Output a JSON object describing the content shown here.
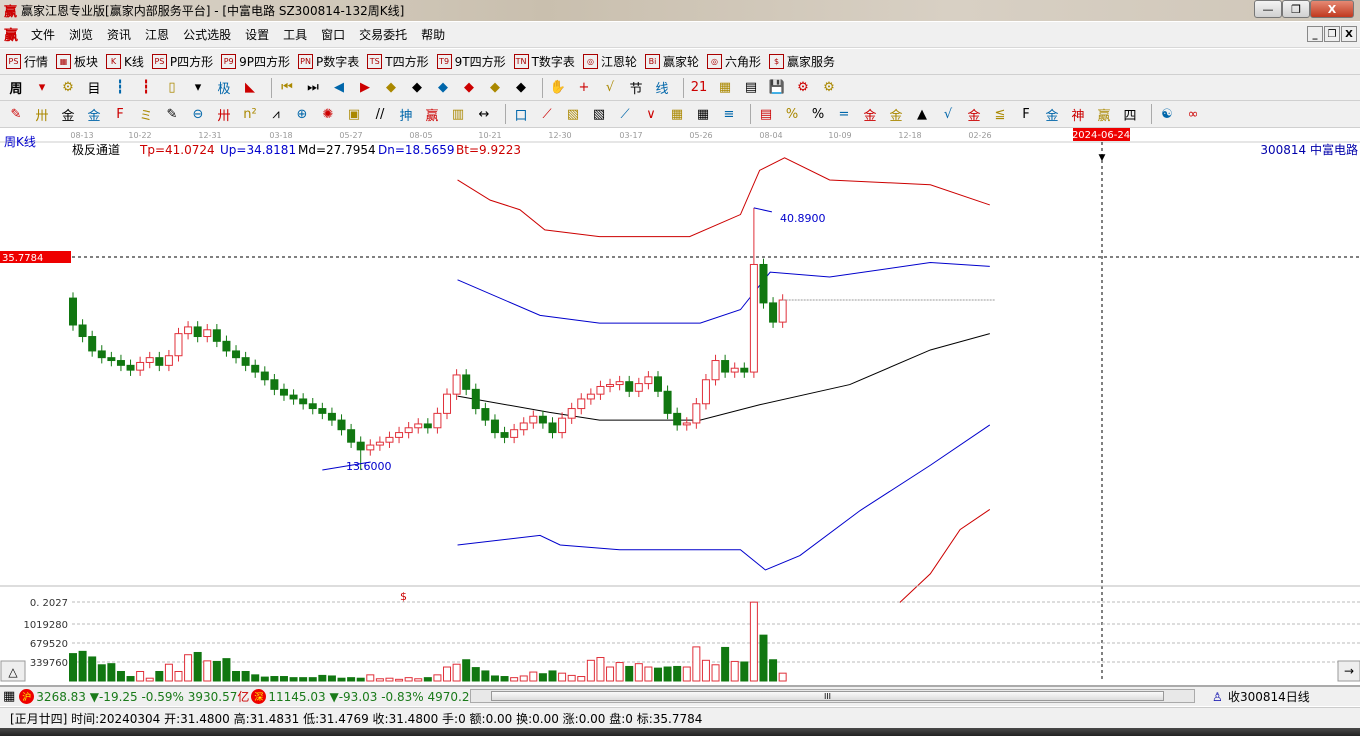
{
  "window": {
    "logo": "赢",
    "title": "赢家江恩专业版[赢家内部服务平台] - [中富电路  SZ300814-132周K线]",
    "min": "—",
    "max": "❐",
    "close": "X"
  },
  "menu": {
    "logo": "赢",
    "items": [
      "文件",
      "浏览",
      "资讯",
      "江恩",
      "公式选股",
      "设置",
      "工具",
      "窗口",
      "交易委托",
      "帮助"
    ],
    "mdi": [
      "_",
      "❐",
      "X"
    ]
  },
  "toolbar1": [
    {
      "icon": "PS",
      "label": "行情"
    },
    {
      "icon": "▦",
      "label": "板块"
    },
    {
      "icon": "K",
      "label": "K线"
    },
    {
      "icon": "PS",
      "label": "P四方形"
    },
    {
      "icon": "P9",
      "label": "9P四方形"
    },
    {
      "icon": "PN",
      "label": "P数字表"
    },
    {
      "icon": "TS",
      "label": "T四方形"
    },
    {
      "icon": "T9",
      "label": "9T四方形"
    },
    {
      "icon": "TN",
      "label": "T数字表"
    },
    {
      "icon": "◎",
      "label": "江恩轮"
    },
    {
      "icon": "Bi",
      "label": "赢家轮"
    },
    {
      "icon": "◎",
      "label": "六角形"
    },
    {
      "icon": "$",
      "label": "赢家服务"
    }
  ],
  "toolbar2": {
    "period": "周",
    "icons": [
      "▾",
      "⚙",
      "目",
      "┇",
      "┇",
      "▯",
      "▾",
      "极",
      "◣",
      "⏮",
      "⏭",
      "◀",
      "▶",
      "◆",
      "◆",
      "◆",
      "◆",
      "◆",
      "◆",
      "✋",
      "+",
      "√",
      "节",
      "线",
      "21",
      "▦",
      "▤",
      "💾",
      "⚙",
      "⚙"
    ]
  },
  "toolbar3": {
    "icons": [
      "✎",
      "卅",
      "金",
      "金",
      "F",
      "ミ",
      "✎",
      "⊖",
      "卅",
      "n²",
      "⩘",
      "⊕",
      "✺",
      "▣",
      "//",
      "抻",
      "赢",
      "▥",
      "↔",
      "口",
      "⟋",
      "▧",
      "▧",
      "⟋",
      "∨",
      "▦",
      "▦",
      "≡",
      "▤",
      "%",
      "%",
      "=",
      "金",
      "金",
      "▲",
      "√",
      "金",
      "≦",
      "F",
      "金",
      "神",
      "赢",
      "四",
      "☯",
      "∞"
    ]
  },
  "axis": {
    "dates": [
      "08-13",
      "10-22",
      "12-31",
      "03-18",
      "05-27",
      "08-05",
      "10-21",
      "12-30",
      "03-17",
      "05-26",
      "08-04",
      "10-09",
      "12-18",
      "02-26"
    ],
    "cursor_date": "2024-06-24",
    "period_label": "周K线",
    "stock": "300814  中富电路",
    "price_tag": "35.7784"
  },
  "indicator": {
    "name": "极反通道",
    "tp": "Tp=41.0724",
    "up": "Up=34.8181",
    "md": "Md=27.7954",
    "dn": "Dn=18.5659",
    "bt": "Bt=9.9223"
  },
  "annotations": {
    "high": "40.8900",
    "low": "13.6000",
    "dollar": "$"
  },
  "volume_axis": {
    "top": "0. 2027",
    "l1": "1019280",
    "l2": "679520",
    "l3": "339760"
  },
  "colors": {
    "up": "#e0303a",
    "down": "#117711",
    "tp": "#cc0000",
    "upline": "#0000cc",
    "md": "#000000",
    "dn": "#0000cc",
    "bt": "#cc0000"
  },
  "chart_data": {
    "type": "candlestick",
    "title": "中富电路 SZ300814 周K线",
    "price_axis": {
      "ref_price": 35.7784
    },
    "first_open": 31.5,
    "close": [
      28.7,
      27.5,
      26.0,
      25.3,
      25.0,
      24.5,
      24.0,
      24.8,
      25.3,
      24.5,
      25.5,
      27.8,
      28.5,
      27.5,
      28.2,
      27.0,
      26.0,
      25.3,
      24.5,
      23.8,
      23.0,
      22.0,
      21.4,
      21.0,
      20.5,
      20.0,
      19.5,
      18.8,
      17.8,
      16.5,
      15.7,
      16.2,
      16.5,
      17.0,
      17.5,
      18.0,
      18.4,
      18.0,
      19.5,
      21.5,
      23.5,
      22.0,
      20.0,
      18.8,
      17.5,
      17.0,
      17.8,
      18.5,
      19.2,
      18.5,
      17.5,
      19.0,
      20.0,
      21.0,
      21.5,
      22.3,
      22.5,
      22.8,
      21.8,
      22.6,
      23.3,
      21.8,
      19.5,
      18.3,
      18.5,
      20.5,
      23.0,
      25.0,
      23.8,
      24.2,
      23.8,
      35.0,
      31.0,
      29.0,
      31.3
    ],
    "volume": [
      490000,
      530000,
      430000,
      290000,
      310000,
      170000,
      80000,
      170000,
      50000,
      170000,
      300000,
      170000,
      470000,
      510000,
      360000,
      350000,
      400000,
      170000,
      170000,
      110000,
      70000,
      80000,
      80000,
      60000,
      60000,
      60000,
      100000,
      90000,
      50000,
      60000,
      50000,
      110000,
      40000,
      50000,
      30000,
      60000,
      40000,
      60000,
      110000,
      250000,
      300000,
      380000,
      240000,
      180000,
      90000,
      80000,
      60000,
      90000,
      160000,
      130000,
      180000,
      140000,
      100000,
      80000,
      370000,
      420000,
      250000,
      330000,
      260000,
      310000,
      250000,
      230000,
      250000,
      260000,
      250000,
      610000,
      370000,
      290000,
      600000,
      350000,
      340000,
      1410000,
      820000,
      380000,
      140000
    ],
    "high_label": 40.89,
    "low_label": 13.6,
    "channels": [
      {
        "name": "Tp",
        "color": "#cc0000",
        "points": [
          [
            40.1,
            43.8
          ],
          [
            43.5,
            41.7
          ],
          [
            46.6,
            40.7
          ],
          [
            49.2,
            38.6
          ],
          [
            54.9,
            37.9
          ],
          [
            64.3,
            37.9
          ],
          [
            69.6,
            40.2
          ],
          [
            71.6,
            44.8
          ],
          [
            74.2,
            46.1
          ],
          [
            78.9,
            43.8
          ],
          [
            89.4,
            43.3
          ],
          [
            95.6,
            41.2
          ]
        ]
      },
      {
        "name": "Up",
        "color": "#0000cc",
        "points": [
          [
            40.1,
            33.4
          ],
          [
            48.7,
            29.7
          ],
          [
            54.9,
            28.9
          ],
          [
            65.4,
            28.9
          ],
          [
            69.6,
            30.3
          ],
          [
            72.7,
            34.2
          ],
          [
            78.9,
            33.7
          ],
          [
            89.4,
            35.2
          ],
          [
            95.6,
            34.8
          ]
        ]
      },
      {
        "name": "Md",
        "color": "#000000",
        "points": [
          [
            40.1,
            21.3
          ],
          [
            49.7,
            19.6
          ],
          [
            54.9,
            18.8
          ],
          [
            65.4,
            18.8
          ],
          [
            71.6,
            20.4
          ],
          [
            81.0,
            22.5
          ],
          [
            89.4,
            26.1
          ],
          [
            95.6,
            27.8
          ]
        ]
      },
      {
        "name": "Dn",
        "color": "#0000cc",
        "points": [
          [
            40.1,
            5.8
          ],
          [
            48.7,
            6.8
          ],
          [
            50.8,
            5.8
          ],
          [
            57.0,
            5.3
          ],
          [
            69.6,
            5.3
          ],
          [
            72.2,
            3.2
          ],
          [
            75.8,
            4.7
          ],
          [
            82.1,
            9.4
          ],
          [
            89.4,
            14.1
          ],
          [
            95.6,
            18.3
          ]
        ]
      },
      {
        "name": "Bt",
        "color": "#cc0000",
        "points": [
          [
            86.2,
            -0.2
          ],
          [
            89.4,
            2.8
          ],
          [
            92.5,
            7.4
          ],
          [
            95.6,
            9.5
          ]
        ]
      }
    ]
  },
  "status": {
    "sh_badge": "沪",
    "sh": "3268.83",
    "sh_chg": "▼-19.25 -0.59% 3930.57",
    "unit": "亿",
    "sz_badge": "深",
    "sz": "11145.03",
    "sz_chg": "▼-93.03 -0.83% 4970.2",
    "scroll_grip": "III",
    "right": "收300814日线"
  },
  "info": "[正月廿四] 时间:20240304 开:31.4800 高:31.4831 低:31.4769 收:31.4800 手:0 额:0.00 换:0.00 涨:0.00 盘:0 标:35.7784"
}
